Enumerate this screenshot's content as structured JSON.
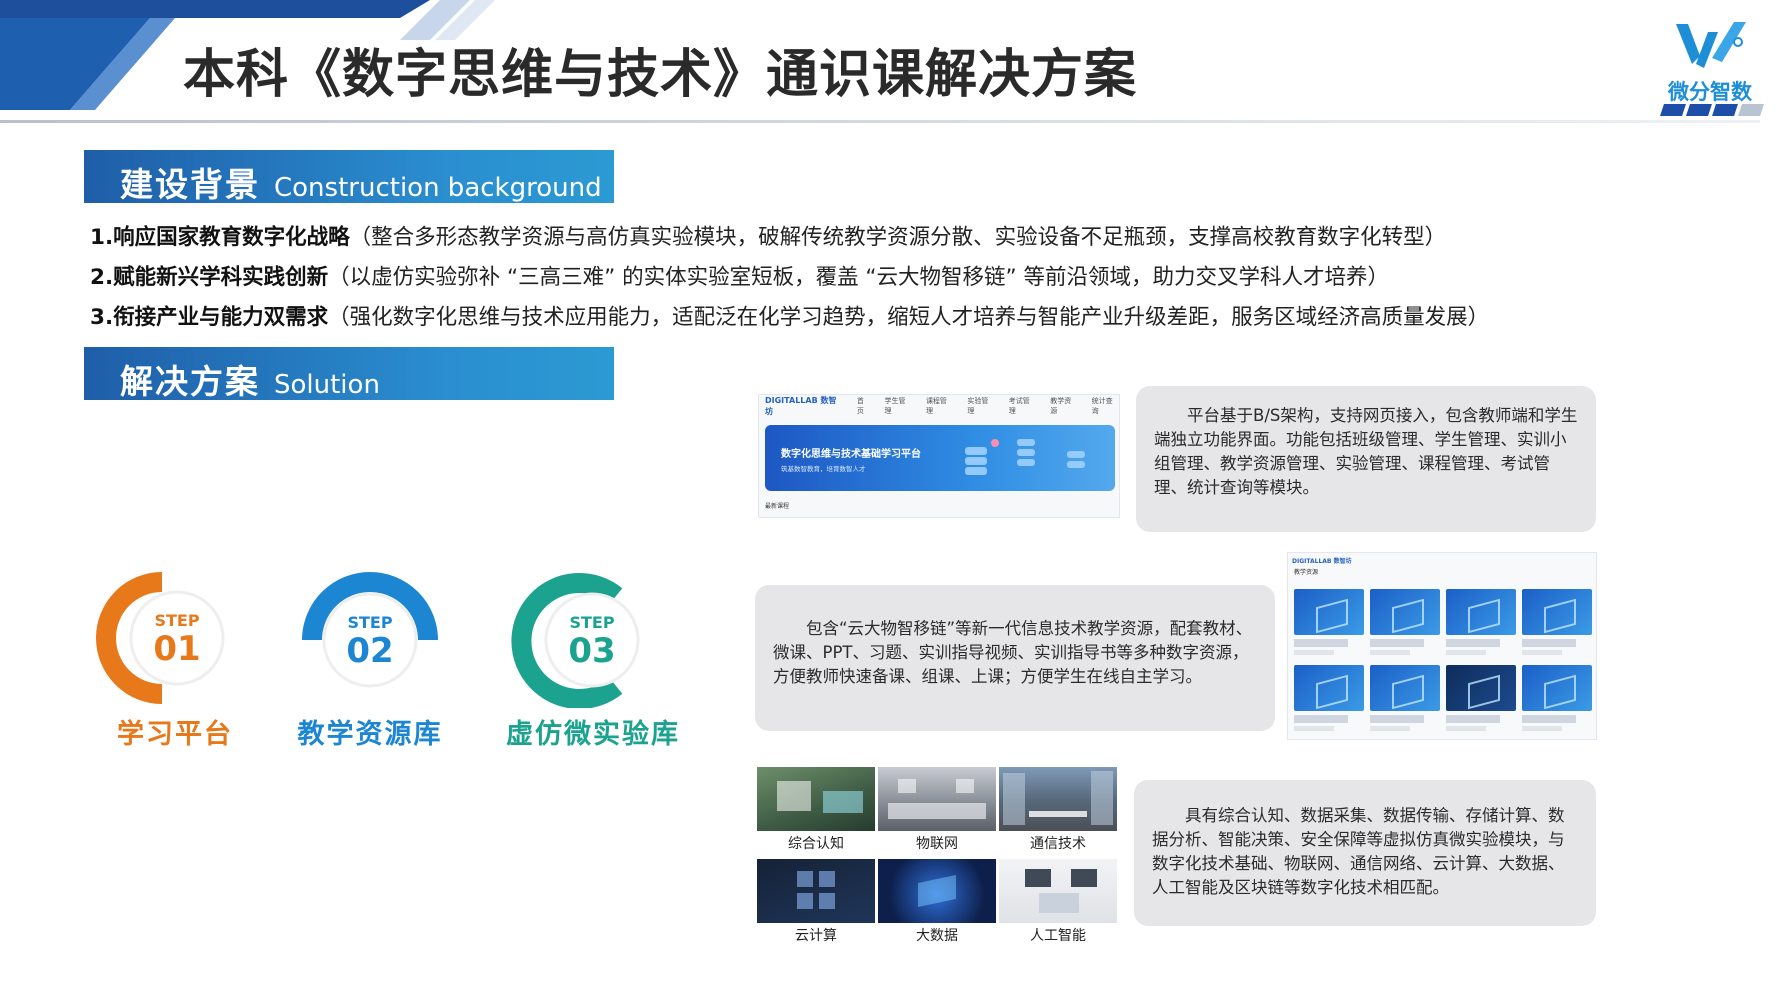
{
  "header": {
    "title": "本科《数字思维与技术》通识课解决方案",
    "logo_text": "微分智数",
    "colors": {
      "primary": "#1f5ea9",
      "accent": "#2a8fd0",
      "logo": "#1e8fd6"
    }
  },
  "background_section": {
    "title_zh": "建设背景",
    "title_en": "Construction background",
    "points": [
      {
        "lead": "1.响应国家教育数字化战略",
        "detail": "（整合多形态教学资源与高仿真实验模块，破解传统教学资源分散、实验设备不足瓶颈，支撑高校教育数字化转型）"
      },
      {
        "lead": "2.赋能新兴学科实践创新",
        "detail": "（以虚仿实验弥补 “三高三难” 的实体实验室短板，覆盖 “云大物智移链” 等前沿领域，助力交叉学科人才培养）"
      },
      {
        "lead": "3.衔接产业与能力双需求",
        "detail": "（强化数字化思维与技术应用能力，适配泛在化学习趋势，缩短人才培养与智能产业升级差距，服务区域经济高质量发展）"
      }
    ]
  },
  "solution_section": {
    "title_zh": "解决方案",
    "title_en": "Solution",
    "steps": [
      {
        "step_word": "STEP",
        "number": "01",
        "label": "学习平台",
        "color": "#e8791b"
      },
      {
        "step_word": "STEP",
        "number": "02",
        "label": "教学资源库",
        "color": "#1d86d3"
      },
      {
        "step_word": "STEP",
        "number": "03",
        "label": "虚仿微实验库",
        "color": "#1ba38f"
      }
    ],
    "descriptions": {
      "platform": "平台基于B/S架构，支持网页接入，包含教师端和学生端独立功能界面。功能包括班级管理、学生管理、实训小组管理、教学资源管理、实验管理、课程管理、考试管理、统计查询等模块。",
      "resources": "包含“云大物智移链”等新一代信息技术教学资源，配套教材、微课、PPT、习题、实训指导视频、实训指导书等多种数字资源，方便教师快速备课、组课、上课；方便学生在线自主学习。",
      "labs": "具有综合认知、数据采集、数据传输、存储计算、数据分析、智能决策、安全保障等虚拟仿真微实验模块，与数字化技术基础、物联网、通信网络、云计算、大数据、人工智能及区块链等数字化技术相匹配。"
    },
    "platform_screenshot": {
      "brand": "DIGITALLAB 数智坊",
      "nav": [
        "首页",
        "学生管理",
        "课程管理",
        "实验管理",
        "考试管理",
        "教学资源",
        "统计查询"
      ],
      "banner_title": "数字化思维与技术基础学习平台",
      "banner_subtitle": "筑基数智教育，培育数智人才",
      "footer": "最新课程"
    },
    "resource_screenshot": {
      "brand": "DIGITALLAB 数智坊",
      "section": "教学资源"
    },
    "labs": [
      "综合认知",
      "物联网",
      "通信技术",
      "云计算",
      "大数据",
      "人工智能"
    ]
  }
}
